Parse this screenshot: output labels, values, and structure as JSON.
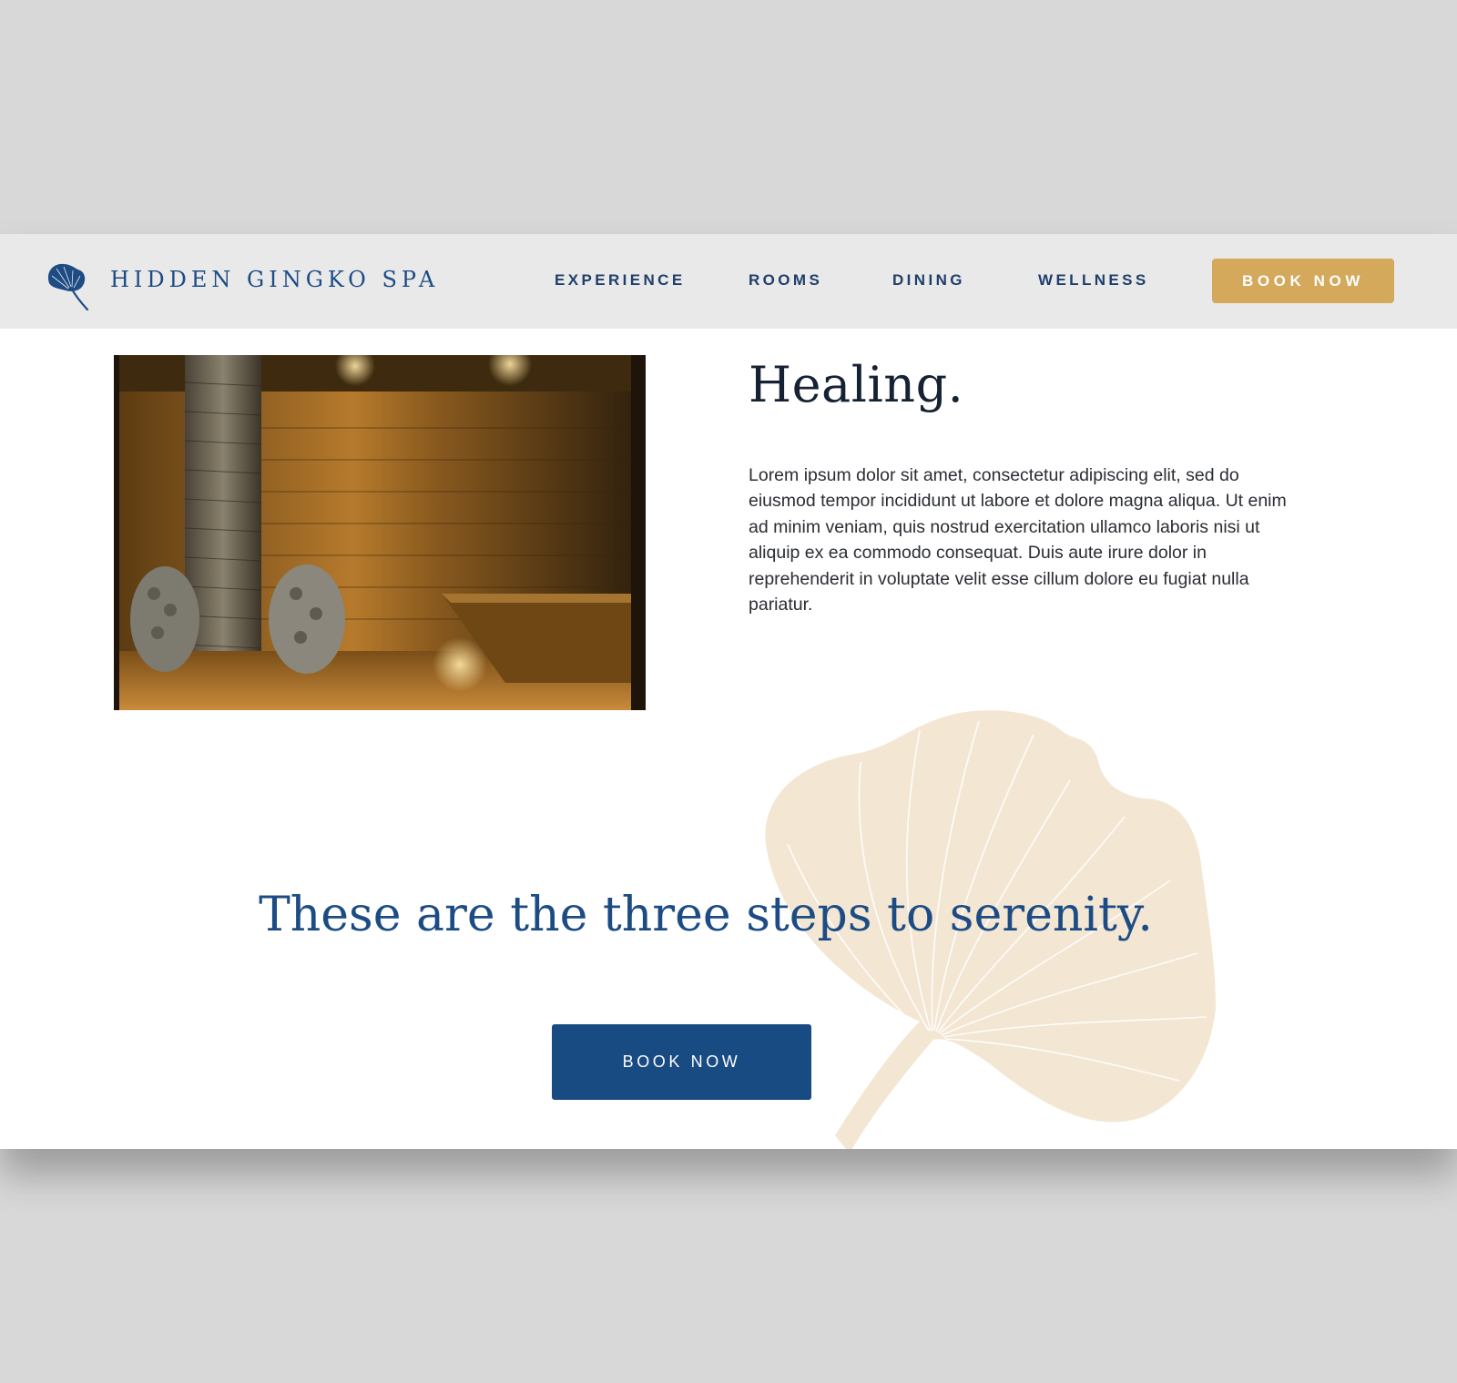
{
  "header": {
    "brand": "HIDDEN GINGKO SPA",
    "logo_icon": "ginkgo-leaf-icon",
    "nav": [
      "EXPERIENCE",
      "ROOMS",
      "DINING",
      "WELLNESS"
    ],
    "book_now": "BOOK NOW"
  },
  "feature": {
    "image": "sauna-room-photo",
    "title": "Healing.",
    "body": "Lorem ipsum dolor sit amet, consectetur adipiscing elit, sed do eiusmod tempor incididunt ut labore et dolore magna aliqua. Ut enim ad minim veniam, quis nostrud exercitation ullamco laboris nisi ut aliquip ex ea commodo consequat. Duis aute irure dolor in reprehenderit in voluptate velit esse cillum dolore eu fugiat nulla pariatur."
  },
  "cta": {
    "tagline": "These are the three steps to serenity.",
    "book_now": "BOOK NOW",
    "background_icon": "ginkgo-leaf-icon"
  },
  "colors": {
    "brand_blue": "#1d4c84",
    "gold": "#d4a95c",
    "header_bg": "#e9e9ea",
    "leaf_tint": "#f3e6d3"
  }
}
